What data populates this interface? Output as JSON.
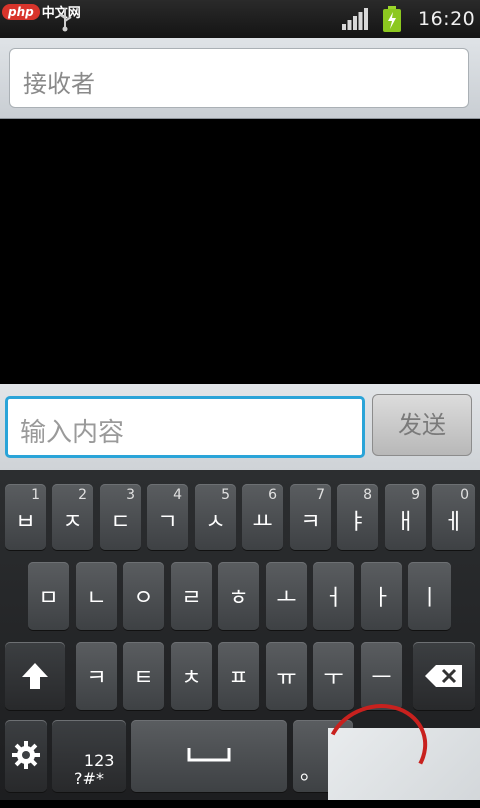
{
  "status_bar": {
    "logo_php": "php",
    "logo_cn": "中文网",
    "time": "16:20"
  },
  "recipient": {
    "placeholder": "接收者"
  },
  "compose": {
    "placeholder": "输入内容",
    "send_label": "发送"
  },
  "keyboard": {
    "row1": [
      {
        "main": "ㅂ",
        "sub": "1"
      },
      {
        "main": "ㅈ",
        "sub": "2"
      },
      {
        "main": "ㄷ",
        "sub": "3"
      },
      {
        "main": "ㄱ",
        "sub": "4"
      },
      {
        "main": "ㅅ",
        "sub": "5"
      },
      {
        "main": "ㅛ",
        "sub": "6"
      },
      {
        "main": "ㅋ",
        "sub": "7"
      },
      {
        "main": "ㅑ",
        "sub": "8"
      },
      {
        "main": "ㅐ",
        "sub": "9"
      },
      {
        "main": "ㅔ",
        "sub": "0"
      }
    ],
    "row2": [
      "ㅁ",
      "ㄴ",
      "ㅇ",
      "ㄹ",
      "ㅎ",
      "ㅗ",
      "ㅓ",
      "ㅏ",
      "ㅣ"
    ],
    "row3": [
      "ㅋ",
      "ㅌ",
      "ㅊ",
      "ㅍ",
      "ㅠ",
      "ㅜ",
      "ㅡ"
    ],
    "symbols_key": "123\n?#*",
    "period_key": "。"
  }
}
